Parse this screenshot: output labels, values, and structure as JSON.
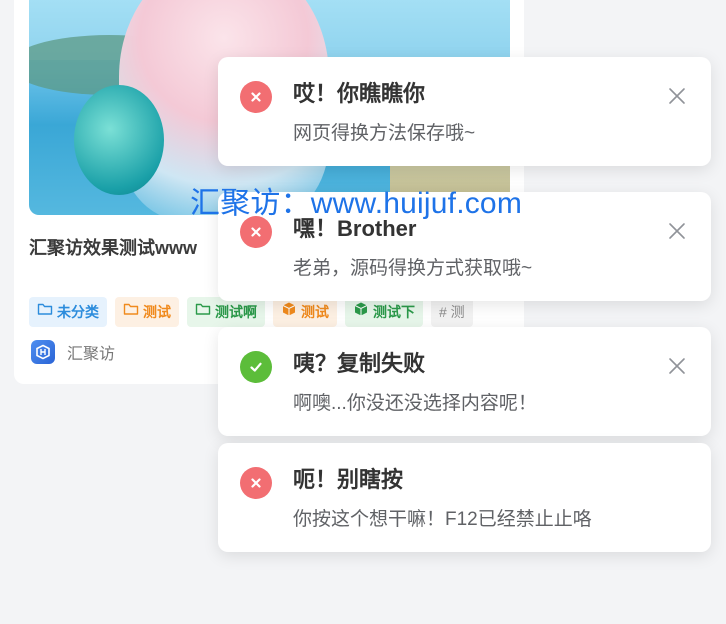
{
  "post": {
    "title": "汇聚访效果测试www",
    "tags": [
      {
        "label": "未分类",
        "icon": "folder-icon"
      },
      {
        "label": "测试",
        "icon": "folder-icon"
      },
      {
        "label": "测试啊",
        "icon": "folder-icon"
      },
      {
        "label": "测试",
        "icon": "cube-icon"
      },
      {
        "label": "测试下",
        "icon": "cube-icon"
      },
      {
        "label": "# 测"
      }
    ],
    "author": "汇聚访"
  },
  "watermark": "汇聚访：www.huijuf.com",
  "notifications": [
    {
      "type": "error",
      "title": "哎！你瞧瞧你",
      "message": "网页得换方法保存哦~"
    },
    {
      "type": "error",
      "title": "嘿！Brother",
      "message": "老弟，源码得换方式获取哦~"
    },
    {
      "type": "success",
      "title": "咦？复制失败",
      "message": "啊噢...你没还没选择内容呢！"
    },
    {
      "type": "error",
      "title": "呃！别瞎按",
      "message": "你按这个想干嘛！F12已经禁止止咯"
    }
  ],
  "colors": {
    "error": "#f26e72",
    "success": "#5cbd3a",
    "watermark": "#1e73e8",
    "tag_blue": "#2c8cdc",
    "tag_orange": "#f08a1d",
    "tag_green": "#2b9a4a"
  }
}
